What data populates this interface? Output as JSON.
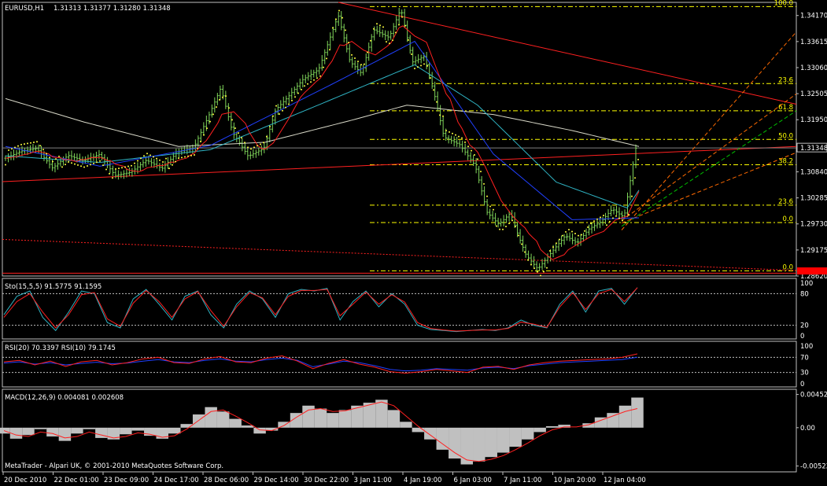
{
  "header": {
    "symbol": "EURUSD,H1",
    "ohlc": "1.31313 1.31377 1.31280 1.31348"
  },
  "footer": {
    "copyright": "MetaTrader - Alpari UK, © 2001-2010 MetaQuotes Software Corp."
  },
  "colors": {
    "background": "#000000",
    "candle": "#7fd45a",
    "fib_level": "#ffff00",
    "trendline_red": "#ff2020",
    "ma_cyan": "#2fb4c4",
    "ma_white": "#d8d8c8",
    "ma_blue": "#2040ff",
    "ma_red": "#ff2020",
    "sar_yellow": "#ffff40",
    "channel_orange": "#ff6a00",
    "channel_green": "#00c000",
    "current_price_tag": "#ff0000",
    "macd_hist": "#c0c0c0"
  },
  "chart_data": [
    {
      "type": "candlestick",
      "panel": "price",
      "title": "EURUSD,H1",
      "ylim": [
        1.2862,
        1.3445
      ],
      "y_ticks": [
        "1.34170",
        "1.33615",
        "1.33060",
        "1.32505",
        "1.31950",
        "1.31348",
        "1.30840",
        "1.30285",
        "1.29730",
        "1.29175",
        "1.28620"
      ],
      "x_ticks": [
        "20 Dec 2010",
        "22 Dec 01:00",
        "23 Dec 09:00",
        "24 Dec 17:00",
        "28 Dec 06:00",
        "29 Dec 14:00",
        "30 Dec 22:00",
        "3 Jan 11:00",
        "4 Jan 19:00",
        "6 Jan 03:00",
        "7 Jan 11:00",
        "10 Jan 20:00",
        "12 Jan 04:00"
      ],
      "current_price": "1.31348",
      "current_price_value": 1.31348,
      "bottom_tag_value": 1.2872,
      "fibonacci_levels": [
        {
          "label": "100.0",
          "price": 1.3436
        },
        {
          "label": "23.6",
          "price": 1.3272
        },
        {
          "label": "61.8",
          "price": 1.3214
        },
        {
          "label": "50.0",
          "price": 1.3153
        },
        {
          "label": "38.2",
          "price": 1.3099
        },
        {
          "label": "23.6",
          "price": 1.3013
        },
        {
          "label": "0.0",
          "price": 1.2976
        },
        {
          "label": "0.0",
          "price": 1.2873
        }
      ],
      "close_path": [
        [
          0,
          1.3113
        ],
        [
          20,
          1.3128
        ],
        [
          40,
          1.3134
        ],
        [
          60,
          1.3092
        ],
        [
          80,
          1.3119
        ],
        [
          100,
          1.3108
        ],
        [
          120,
          1.3121
        ],
        [
          140,
          1.3076
        ],
        [
          160,
          1.3083
        ],
        [
          180,
          1.3109
        ],
        [
          200,
          1.3091
        ],
        [
          220,
          1.3127
        ],
        [
          240,
          1.3134
        ],
        [
          260,
          1.3205
        ],
        [
          275,
          1.3263
        ],
        [
          290,
          1.3168
        ],
        [
          310,
          1.3117
        ],
        [
          330,
          1.3134
        ],
        [
          345,
          1.3216
        ],
        [
          360,
          1.3242
        ],
        [
          380,
          1.3281
        ],
        [
          400,
          1.3302
        ],
        [
          415,
          1.3372
        ],
        [
          425,
          1.3418
        ],
        [
          440,
          1.3319
        ],
        [
          455,
          1.3293
        ],
        [
          470,
          1.3387
        ],
        [
          490,
          1.337
        ],
        [
          505,
          1.3432
        ],
        [
          520,
          1.3318
        ],
        [
          535,
          1.333
        ],
        [
          550,
          1.3234
        ],
        [
          560,
          1.3158
        ],
        [
          580,
          1.3142
        ],
        [
          600,
          1.3097
        ],
        [
          615,
          1.2998
        ],
        [
          630,
          1.2972
        ],
        [
          645,
          1.2996
        ],
        [
          655,
          1.2948
        ],
        [
          665,
          1.2906
        ],
        [
          680,
          1.2877
        ],
        [
          700,
          1.2918
        ],
        [
          715,
          1.2948
        ],
        [
          730,
          1.2932
        ],
        [
          745,
          1.2962
        ],
        [
          760,
          1.2977
        ],
        [
          775,
          1.3005
        ],
        [
          790,
          1.2987
        ],
        [
          805,
          1.3134
        ]
      ],
      "ma_white_path": [
        [
          0,
          1.324
        ],
        [
          100,
          1.319
        ],
        [
          220,
          1.3138
        ],
        [
          330,
          1.3147
        ],
        [
          440,
          1.3194
        ],
        [
          510,
          1.3226
        ],
        [
          620,
          1.3206
        ],
        [
          720,
          1.3172
        ],
        [
          805,
          1.3138
        ]
      ],
      "ma_cyan_path": [
        [
          0,
          1.3118
        ],
        [
          120,
          1.3104
        ],
        [
          260,
          1.3131
        ],
        [
          400,
          1.3228
        ],
        [
          520,
          1.3312
        ],
        [
          600,
          1.3226
        ],
        [
          700,
          1.3062
        ],
        [
          790,
          1.3007
        ],
        [
          805,
          1.3045
        ]
      ],
      "ma_blue_path": [
        [
          0,
          1.3138
        ],
        [
          120,
          1.3096
        ],
        [
          260,
          1.314
        ],
        [
          420,
          1.3275
        ],
        [
          520,
          1.3362
        ],
        [
          620,
          1.3122
        ],
        [
          720,
          1.2982
        ],
        [
          805,
          1.2986
        ]
      ]
    },
    {
      "type": "line",
      "panel": "stochastic",
      "label": "Sto(15,5,5) 91.5775 91.1595",
      "ylim": [
        0,
        100
      ],
      "levels": [
        "100",
        "80",
        "20",
        "0"
      ],
      "level_values": [
        100,
        80,
        20,
        0
      ],
      "series": [
        {
          "name": "%K",
          "color": "#2fb4c4",
          "values": [
            40,
            75,
            85,
            35,
            10,
            45,
            85,
            80,
            25,
            15,
            70,
            88,
            60,
            30,
            75,
            85,
            40,
            15,
            60,
            85,
            70,
            35,
            80,
            88,
            85,
            90,
            30,
            65,
            85,
            55,
            80,
            60,
            20,
            12,
            10,
            8,
            10,
            12,
            10,
            15,
            30,
            20,
            15,
            60,
            85,
            45,
            85,
            90,
            60,
            91.6
          ]
        },
        {
          "name": "%D",
          "color": "#ff2020",
          "values": [
            35,
            65,
            80,
            45,
            15,
            40,
            78,
            82,
            32,
            18,
            62,
            86,
            65,
            35,
            70,
            84,
            48,
            18,
            55,
            82,
            72,
            40,
            75,
            86,
            86,
            88,
            38,
            60,
            83,
            60,
            78,
            64,
            25,
            14,
            11,
            9,
            10,
            11,
            11,
            14,
            26,
            22,
            16,
            55,
            82,
            50,
            80,
            88,
            65,
            91.2
          ]
        }
      ]
    },
    {
      "type": "line",
      "panel": "rsi",
      "label": "RSI(20) 70.3397 RSI(10) 79.1745",
      "ylim": [
        0,
        100
      ],
      "levels": [
        "100",
        "70",
        "30",
        "0"
      ],
      "level_values": [
        100,
        70,
        30,
        0
      ],
      "series": [
        {
          "name": "RSI(20)",
          "color": "#2040ff",
          "values": [
            55,
            58,
            52,
            56,
            50,
            54,
            57,
            53,
            55,
            60,
            64,
            58,
            56,
            62,
            66,
            60,
            58,
            64,
            68,
            62,
            45,
            52,
            60,
            56,
            48,
            38,
            34,
            36,
            40,
            38,
            36,
            42,
            44,
            40,
            48,
            52,
            56,
            58,
            60,
            62,
            64,
            70.3
          ]
        },
        {
          "name": "RSI(10)",
          "color": "#ff2020",
          "values": [
            58,
            62,
            50,
            60,
            46,
            58,
            62,
            50,
            56,
            66,
            70,
            56,
            54,
            66,
            72,
            58,
            56,
            68,
            74,
            60,
            40,
            54,
            64,
            52,
            44,
            32,
            28,
            32,
            38,
            34,
            30,
            44,
            46,
            38,
            50,
            56,
            60,
            62,
            64,
            66,
            70,
            79.2
          ]
        }
      ]
    },
    {
      "type": "bar",
      "panel": "macd",
      "label": "MACD(12,26,9) 0.004081 0.002608",
      "ylim": [
        -0.0058,
        0.0048
      ],
      "y_ticks": [
        "0.004524",
        "0.00",
        "-0.005221"
      ],
      "y_tick_values": [
        0.004524,
        0,
        -0.005221
      ],
      "histogram": [
        -0.0008,
        -0.0015,
        -0.001,
        -0.0002,
        -0.0012,
        -0.0018,
        -0.0008,
        -0.0002,
        -0.0014,
        -0.0016,
        -0.0009,
        -0.0004,
        -0.0011,
        -0.0015,
        -0.0008,
        0.0005,
        0.0018,
        0.0028,
        0.0022,
        0.0012,
        0.0003,
        -0.0008,
        -0.0004,
        0.0008,
        0.002,
        0.003,
        0.0026,
        0.002,
        0.0024,
        0.003,
        0.0034,
        0.0038,
        0.0024,
        0.0008,
        -0.0006,
        -0.0016,
        -0.003,
        -0.0042,
        -0.005,
        -0.0046,
        -0.004,
        -0.0034,
        -0.0026,
        -0.0016,
        -0.0006,
        0.0002,
        0.0004,
        0.0,
        0.0006,
        0.0014,
        0.002,
        0.003,
        0.0041
      ],
      "signal": [
        -0.0004,
        -0.001,
        -0.0012,
        -0.0006,
        -0.0008,
        -0.0014,
        -0.0012,
        -0.0006,
        -0.001,
        -0.0014,
        -0.0012,
        -0.0007,
        -0.0009,
        -0.0013,
        -0.0011,
        -0.0002,
        0.001,
        0.0022,
        0.0024,
        0.0016,
        0.0007,
        -0.0003,
        -0.0004,
        0.0003,
        0.0014,
        0.0024,
        0.0026,
        0.0022,
        0.0023,
        0.0027,
        0.0031,
        0.0035,
        0.003,
        0.0016,
        0.0002,
        -0.001,
        -0.0022,
        -0.0034,
        -0.0044,
        -0.0046,
        -0.0043,
        -0.0038,
        -0.003,
        -0.0021,
        -0.0011,
        -0.0003,
        0.0001,
        0.0001,
        0.0004,
        0.001,
        0.0016,
        0.0022,
        0.0026
      ]
    }
  ]
}
